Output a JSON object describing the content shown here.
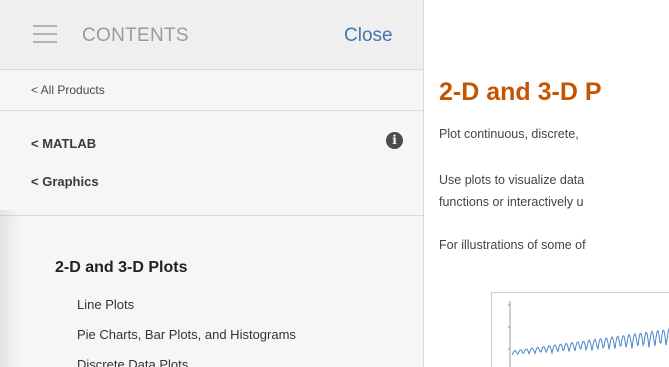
{
  "sidebar": {
    "header": {
      "title": "CONTENTS",
      "close_label": "Close"
    },
    "all_products_label": "< All Products",
    "breadcrumbs": [
      {
        "label": "< MATLAB"
      },
      {
        "label": "< Graphics"
      }
    ],
    "section_title": "2-D and 3-D Plots",
    "items": [
      {
        "label": "Line Plots"
      },
      {
        "label": "Pie Charts, Bar Plots, and Histograms"
      },
      {
        "label": "Discrete Data Plots"
      }
    ]
  },
  "main": {
    "title": "2-D and 3-D P",
    "paragraphs": [
      "Plot continuous, discrete,",
      "Use plots to visualize data",
      "functions or interactively u",
      "For illustrations of some of"
    ]
  },
  "colors": {
    "accent_orange": "#c45400",
    "link_blue": "#4276b3"
  },
  "icons": {
    "menu": "hamburger-menu-icon",
    "info": "info-icon"
  }
}
